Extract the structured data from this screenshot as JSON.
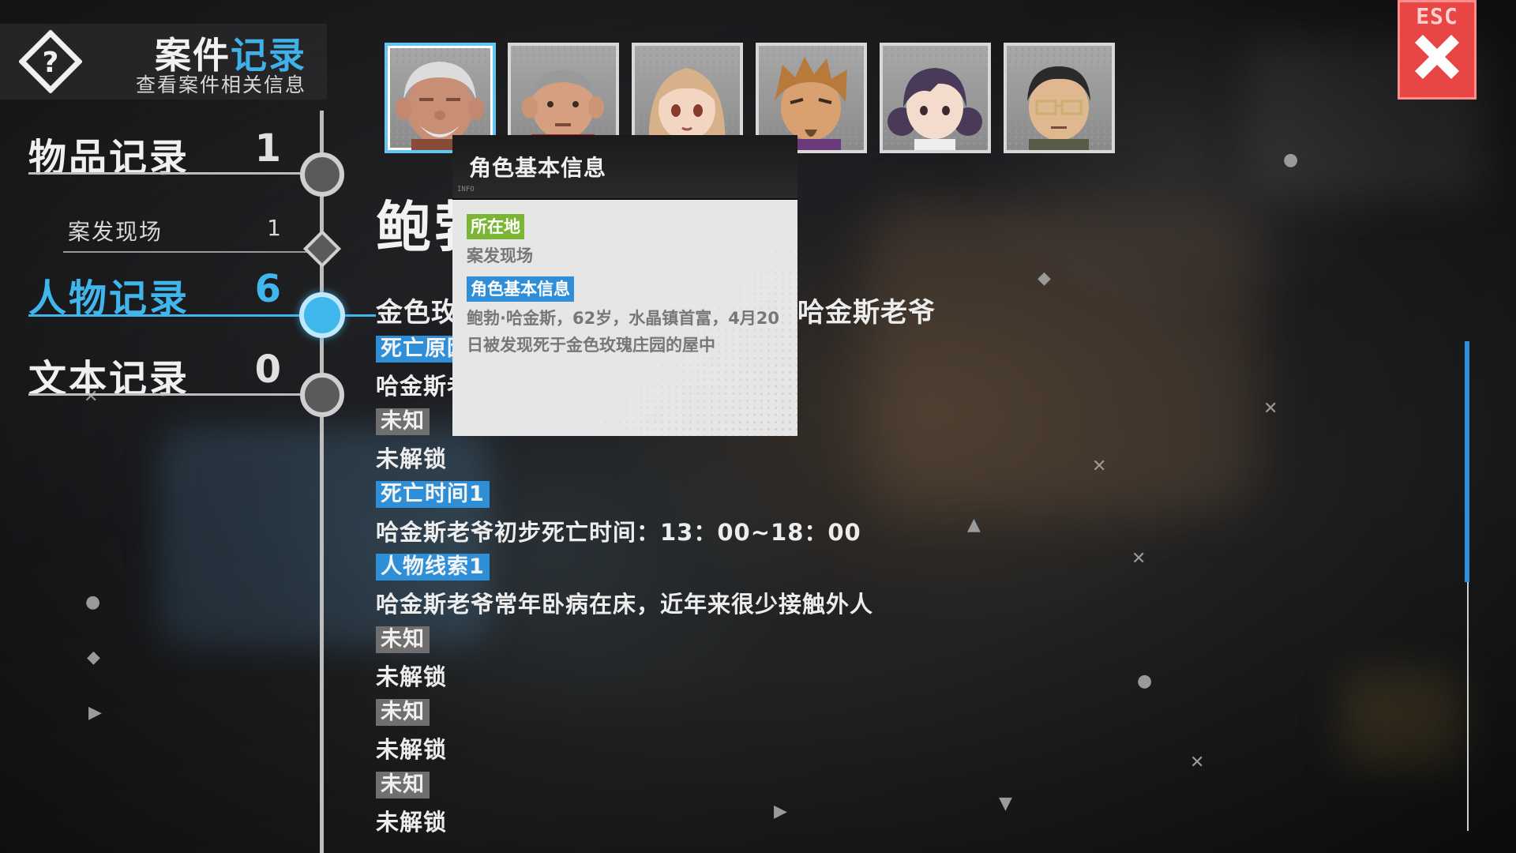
{
  "header": {
    "title_part1": "案件",
    "title_part2": "记录",
    "subtitle": "查看案件相关信息"
  },
  "nav": {
    "items": [
      {
        "label": "物品记录",
        "count": "1"
      },
      {
        "label": "人物记录",
        "count": "6"
      },
      {
        "label": "文本记录",
        "count": "0"
      }
    ],
    "sub_item": {
      "label": "案发现场",
      "count": "1"
    },
    "active_index": 1
  },
  "close": {
    "label": "ESC",
    "icon": "close-x-icon"
  },
  "portraits": [
    {
      "name": "old-man-white-hair",
      "selected": true
    },
    {
      "name": "bald-man-red-collar",
      "selected": false
    },
    {
      "name": "blonde-girl",
      "selected": false
    },
    {
      "name": "spiky-hair-man",
      "selected": false
    },
    {
      "name": "purple-hair-woman",
      "selected": false
    },
    {
      "name": "man-with-glasses",
      "selected": false
    }
  ],
  "character": {
    "name_visible": "鲍勃",
    "subtitle_left": "金色玫",
    "subtitle_right": "哈金斯老爷"
  },
  "entries": [
    {
      "tag": "死亡原因",
      "tag_color": "blue",
      "text": "哈金斯老"
    },
    {
      "tag": "未知",
      "tag_color": "gray",
      "text": "未解锁"
    },
    {
      "tag": "死亡时间1",
      "tag_color": "blue",
      "text": "哈金斯老爷初步死亡时间：13：00~18：00"
    },
    {
      "tag": "人物线索1",
      "tag_color": "blue",
      "text": "哈金斯老爷常年卧病在床，近年来很少接触外人"
    },
    {
      "tag": "未知",
      "tag_color": "gray",
      "text": "未解锁"
    },
    {
      "tag": "未知",
      "tag_color": "gray",
      "text": "未解锁"
    },
    {
      "tag": "未知",
      "tag_color": "gray",
      "text": "未解锁"
    }
  ],
  "tooltip": {
    "title": "角色基本信息",
    "info_label": "INFO",
    "location_tag": "所在地",
    "location_value": "案发现场",
    "basic_tag": "角色基本信息",
    "basic_text": "鲍勃·哈金斯，62岁，水晶镇首富，4月20日被发现死于金色玫瑰庄园的屋中"
  },
  "colors": {
    "accent": "#3fb6ec",
    "tag_blue": "#2e8fd8",
    "tag_gray": "#6f6f6f",
    "tag_green": "#7ab534",
    "close_red": "#e84545"
  },
  "scroll": {
    "position": 0.0
  }
}
